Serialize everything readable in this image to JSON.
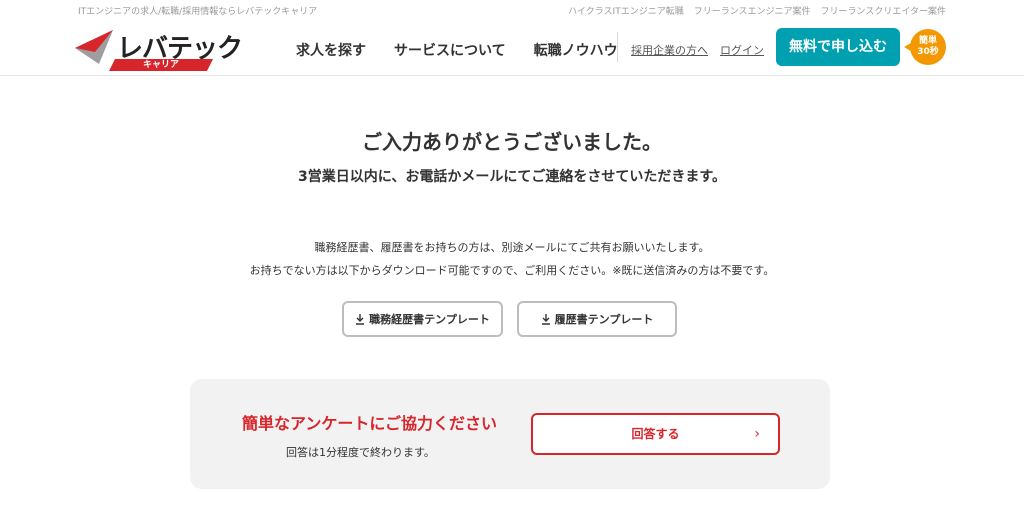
{
  "topbar": {
    "tagline": "ITエンジニアの求人/転職/採用情報ならレバテックキャリア",
    "links": [
      "ハイクラスITエンジニア転職",
      "フリーランスエンジニア案件",
      "フリーランスクリエイター案件"
    ]
  },
  "header": {
    "logo_main": "レバテック",
    "logo_sub": "キャリア",
    "menu": [
      "求人を探す",
      "サービスについて",
      "転職ノウハウ"
    ],
    "corp_link": "採用企業の方へ",
    "login": "ログイン",
    "signup": "無料で申し込む",
    "badge_line1": "簡単",
    "badge_line2": "30秒"
  },
  "main": {
    "title": "ご入力ありがとうございました。",
    "subtitle": "3営業日以内に、お電話かメールにてご連絡をさせていただきます。",
    "note_line1": "職務経歴書、履歴書をお持ちの方は、別途メールにてご共有お願いいたします。",
    "note_line2": "お持ちでない方は以下からダウンロード可能ですので、ご利用ください。※既に送信済みの方は不要です。",
    "templates": [
      "職務経歴書テンプレート",
      "履歴書テンプレート"
    ]
  },
  "survey": {
    "title": "簡単なアンケートにご協力ください",
    "desc": "回答は1分程度で終わります。",
    "button": "回答する",
    "chevron": "›"
  },
  "colors": {
    "brand_red": "#d7262b",
    "cta_teal": "#00a0b0",
    "badge_orange": "#f39800"
  }
}
